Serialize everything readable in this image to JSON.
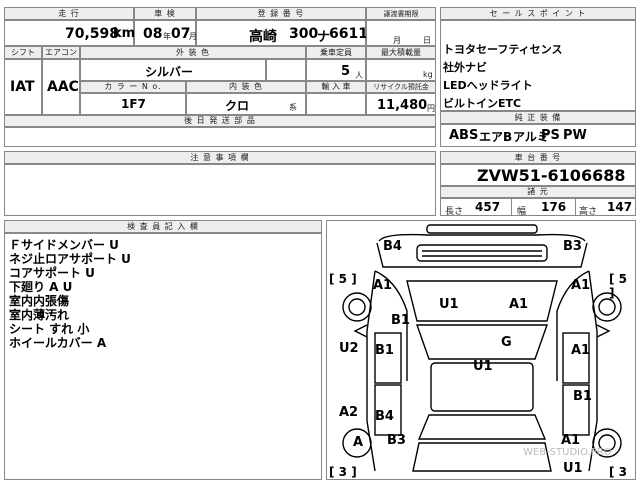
{
  "top": {
    "headers": {
      "mileage": "走 行",
      "inspection": "車 検",
      "registration": "登 録 番 号",
      "transfer_deadline": "譲渡書期限",
      "shift": "シフト",
      "aircon": "エアコン",
      "ext_color": "外 装 色",
      "capacity": "乗車定員",
      "max_load": "最大積載量",
      "color_no": "カ ラ ー N o.",
      "int_color": "内 装 色",
      "import": "輸 入 車",
      "recycle": "リサイクル預託金",
      "delivery": "後 日 発 送 部 品"
    },
    "mileage_value": "70,598",
    "mileage_unit": "km",
    "inspection_year": "08",
    "inspection_year_unit": "年",
    "inspection_month": "07",
    "inspection_month_unit": "月",
    "plate_region": "高崎",
    "plate_class": "300",
    "plate_kana": "ナ",
    "plate_number": "6611",
    "deadline_month_unit": "月",
    "deadline_day_unit": "日",
    "shift_value": "IAT",
    "aircon_value": "AAC",
    "ext_color_value": "シルバー",
    "capacity_value": "5",
    "capacity_unit": "人",
    "max_load_unit": "kg",
    "color_no_value": "1F7",
    "int_color_value": "クロ",
    "int_color_suffix": "系",
    "recycle_value": "11,480",
    "recycle_unit": "円"
  },
  "sales": {
    "header": "セ ー ル ス ポ イ ン ト",
    "items": [
      "トヨタセーフティセンス",
      "社外ナビ",
      "LEDヘッドライト",
      "ビルトインETC"
    ]
  },
  "equipment": {
    "header": "純 正 装 備",
    "items": [
      "ABS",
      "エアB",
      "アルミ",
      "PS",
      "PW"
    ]
  },
  "notes": {
    "header": "注 意 事 項 欄"
  },
  "chassis": {
    "header": "車 台 番 号",
    "value": "ZVW51-6106688"
  },
  "dims": {
    "header": "諸 元",
    "length_label": "長さ",
    "length": "457",
    "width_label": "幅",
    "width": "176",
    "height_label": "高さ",
    "height": "147"
  },
  "inspector": {
    "header": "検 査 員 記 入 欄",
    "lines": [
      "Ｆサイドメンバー U",
      "ネジ止ロアサポート U",
      "コアサポート U",
      "下廻り A U",
      "室内内張傷",
      "室内薄汚れ",
      "シート すれ 小",
      "ホイールカバー A"
    ]
  },
  "diagram": {
    "marks": {
      "b4_tl": "B4",
      "b3_tr": "B3",
      "a1_fl": "A1",
      "a1_fr": "A1",
      "u1_hood": "U1",
      "a1_hood": "A1",
      "b1_left": "B1",
      "g_center": "G",
      "u1_center": "U1",
      "u2_left": "U2",
      "b1_door": "B1",
      "a1_right": "A1",
      "a2_left": "A2",
      "b4_bottom": "B4",
      "b1_rright": "B1",
      "a_wheel": "A",
      "b3_bottom": "B3",
      "a1_bottom": "A1",
      "u1_bottom": "U1"
    },
    "bracket_fl": "[ 5 ]",
    "bracket_fr": "[ 5 ]",
    "bracket_rl": "[ 3 ]",
    "bracket_rr": "[ 3 ]",
    "watermark": "WEB-STUDIO.PRO"
  }
}
